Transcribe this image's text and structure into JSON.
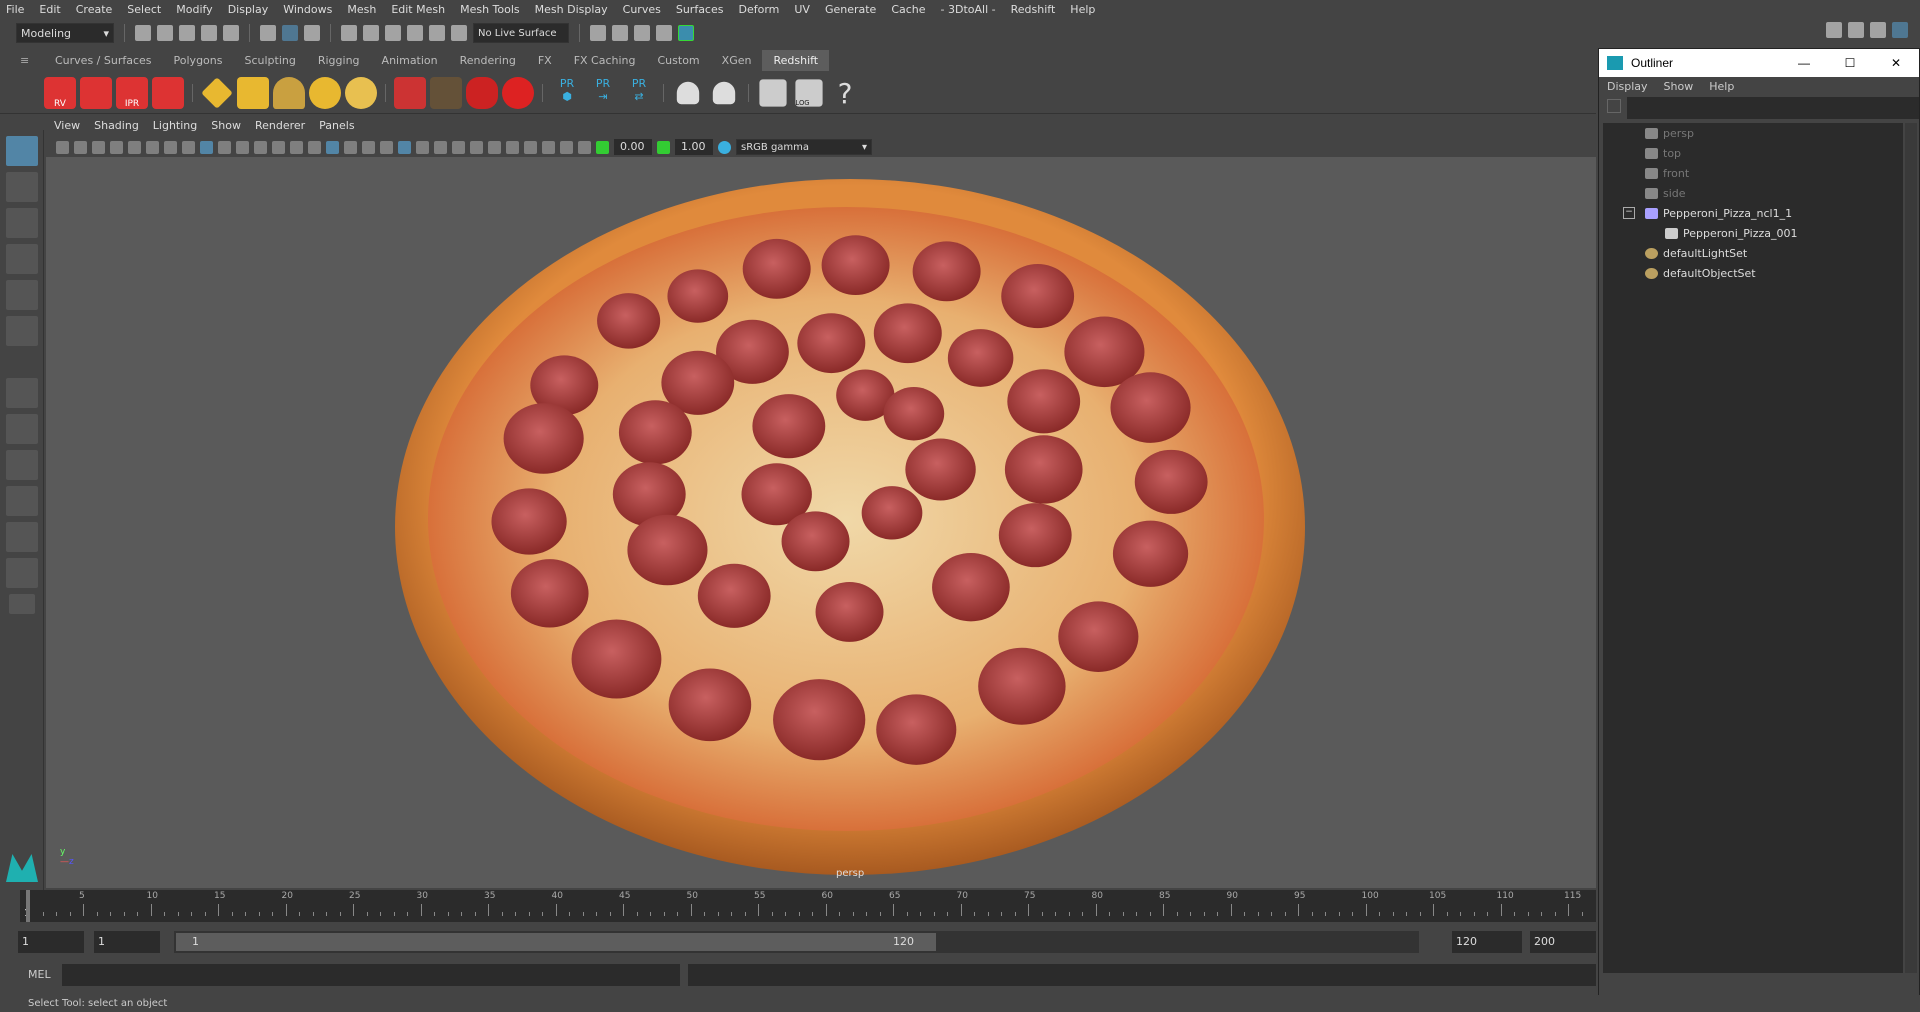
{
  "menubar": [
    "File",
    "Edit",
    "Create",
    "Select",
    "Modify",
    "Display",
    "Windows",
    "Mesh",
    "Edit Mesh",
    "Mesh Tools",
    "Mesh Display",
    "Curves",
    "Surfaces",
    "Deform",
    "UV",
    "Generate",
    "Cache",
    "- 3DtoAll -",
    "Redshift",
    "Help"
  ],
  "toolbar": {
    "workspace": "Modeling",
    "live_surface": "No Live Surface"
  },
  "shelf": {
    "tabs": [
      "Curves / Surfaces",
      "Polygons",
      "Sculpting",
      "Rigging",
      "Animation",
      "Rendering",
      "FX",
      "FX Caching",
      "Custom",
      "XGen",
      "Redshift"
    ],
    "active": "Redshift",
    "icon_labels": [
      "RV",
      "IPR",
      "PR",
      "PR",
      "PR",
      "LOG",
      "?"
    ]
  },
  "viewport": {
    "menu": [
      "View",
      "Shading",
      "Lighting",
      "Show",
      "Renderer",
      "Panels"
    ],
    "exposure": "0.00",
    "gamma": "1.00",
    "color_space": "sRGB gamma",
    "camera": "persp"
  },
  "outliner": {
    "title": "Outliner",
    "menu": [
      "Display",
      "Show",
      "Help"
    ],
    "items": [
      {
        "label": "persp",
        "icon": "camera-icon",
        "dim": true,
        "indent": 0
      },
      {
        "label": "top",
        "icon": "camera-icon",
        "dim": true,
        "indent": 0
      },
      {
        "label": "front",
        "icon": "camera-icon",
        "dim": true,
        "indent": 0
      },
      {
        "label": "side",
        "icon": "camera-icon",
        "dim": true,
        "indent": 0
      },
      {
        "label": "Pepperoni_Pizza_ncl1_1",
        "icon": "group-icon",
        "dim": false,
        "indent": 0,
        "expanded": true
      },
      {
        "label": "Pepperoni_Pizza_001",
        "icon": "mesh-icon",
        "dim": false,
        "indent": 1
      },
      {
        "label": "defaultLightSet",
        "icon": "set-icon",
        "dim": false,
        "indent": 0
      },
      {
        "label": "defaultObjectSet",
        "icon": "set-icon",
        "dim": false,
        "indent": 0
      }
    ]
  },
  "timeline": {
    "ticks": [
      5,
      10,
      15,
      20,
      25,
      30,
      35,
      40,
      45,
      50,
      55,
      60,
      65,
      70,
      75,
      80,
      85,
      90,
      95,
      100,
      105,
      110,
      115
    ],
    "current_frame": "1"
  },
  "range": {
    "start": "1",
    "anim_start": "1",
    "range_start": "1",
    "range_end": "120",
    "anim_end": "120",
    "end": "200"
  },
  "mel": {
    "label": "MEL"
  },
  "status": "Select Tool: select an object"
}
